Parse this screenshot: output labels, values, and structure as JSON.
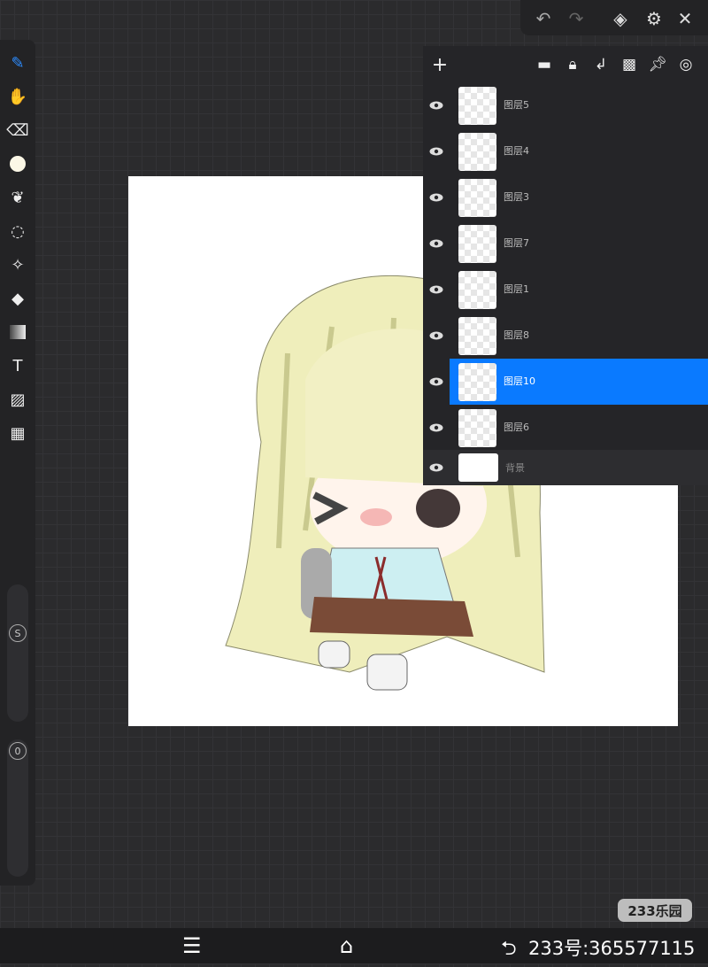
{
  "toolbar": {
    "tools": [
      "brush",
      "smudge",
      "eraser",
      "color",
      "shape",
      "lasso",
      "magic-wand",
      "fill",
      "gradient",
      "text",
      "image",
      "layout"
    ],
    "size_label": "S",
    "opacity_label": "0"
  },
  "topbar": {
    "icons": [
      "undo",
      "redo",
      "layers",
      "settings",
      "close"
    ]
  },
  "layers_panel": {
    "header_icons": [
      "add",
      "folder",
      "lock",
      "merge-down",
      "transparency",
      "pin",
      "target"
    ],
    "layers": [
      {
        "name": "图层5",
        "selected": false
      },
      {
        "name": "图层4",
        "selected": false
      },
      {
        "name": "图层3",
        "selected": false
      },
      {
        "name": "图层7",
        "selected": false
      },
      {
        "name": "图层1",
        "selected": false
      },
      {
        "name": "图层8",
        "selected": false
      },
      {
        "name": "图层10",
        "selected": true
      },
      {
        "name": "图层6",
        "selected": false
      }
    ],
    "background_label": "背景"
  },
  "watermark": {
    "badge": "233乐园",
    "id_text": "233号:365577115"
  },
  "colors": {
    "accent": "#0a7aff",
    "panel": "#252528"
  }
}
